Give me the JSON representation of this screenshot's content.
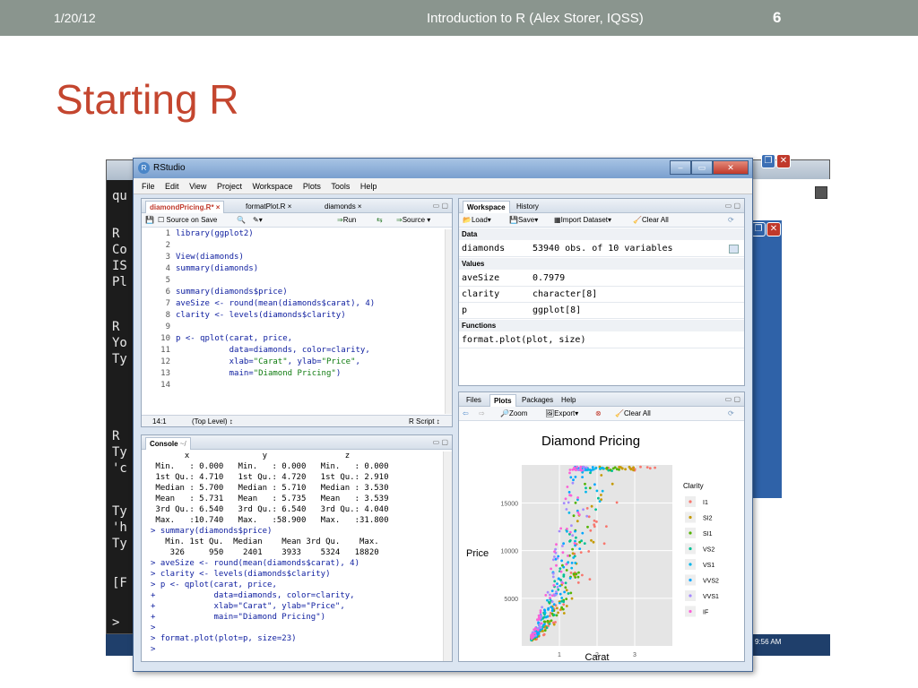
{
  "slide": {
    "date": "1/20/12",
    "course": "Introduction to R (Alex Storer, IQSS)",
    "page_number": "6",
    "title": "Starting R"
  },
  "background_console": {
    "lines": [
      "qu",
      "R",
      "Co",
      "IS",
      "Pl",
      "R",
      "Yo",
      "Ty",
      "R",
      "Ty",
      "'c",
      "Ty",
      "'h",
      "Ty",
      "[F",
      ">"
    ],
    "taskbar_time": "9:56 AM"
  },
  "rstudio": {
    "title": "RStudio",
    "menu": [
      "File",
      "Edit",
      "View",
      "Project",
      "Workspace",
      "Plots",
      "Tools",
      "Help"
    ],
    "editor": {
      "tabs": [
        "diamondPricing.R*",
        "formatPlot.R",
        "diamonds"
      ],
      "toolbar": {
        "source_on_save": "Source on Save",
        "run": "Run",
        "source": "Source"
      },
      "lines": [
        {
          "n": "1",
          "text": "library(ggplot2)"
        },
        {
          "n": "2",
          "text": ""
        },
        {
          "n": "3",
          "text": "View(diamonds)"
        },
        {
          "n": "4",
          "text": "summary(diamonds)"
        },
        {
          "n": "5",
          "text": ""
        },
        {
          "n": "6",
          "text": "summary(diamonds$price)"
        },
        {
          "n": "7",
          "text": "aveSize <- round(mean(diamonds$carat), 4)"
        },
        {
          "n": "8",
          "text": "clarity <- levels(diamonds$clarity)"
        },
        {
          "n": "9",
          "text": ""
        },
        {
          "n": "10",
          "text": "p <- qplot(carat, price,"
        },
        {
          "n": "11",
          "text": "           data=diamonds, color=clarity,"
        },
        {
          "n": "12",
          "text": "           xlab=\"Carat\", ylab=\"Price\","
        },
        {
          "n": "13",
          "text": "           main=\"Diamond Pricing\")"
        },
        {
          "n": "14",
          "text": ""
        }
      ],
      "status_pos": "14:1",
      "status_scope": "(Top Level) ↕",
      "status_type": "R Script ↕"
    },
    "console": {
      "title": "Console",
      "path": "~/",
      "lines": [
        "       x               y                z        ",
        " Min.   : 0.000   Min.   : 0.000   Min.   : 0.000",
        " 1st Qu.: 4.710   1st Qu.: 4.720   1st Qu.: 2.910",
        " Median : 5.700   Median : 5.710   Median : 3.530",
        " Mean   : 5.731   Mean   : 5.735   Mean   : 3.539",
        " 3rd Qu.: 6.540   3rd Qu.: 6.540   3rd Qu.: 4.040",
        " Max.   :10.740   Max.   :58.900   Max.   :31.800",
        "> summary(diamonds$price)",
        "   Min. 1st Qu.  Median    Mean 3rd Qu.    Max. ",
        "    326     950    2401    3933    5324   18820 ",
        "> aveSize <- round(mean(diamonds$carat), 4)",
        "> clarity <- levels(diamonds$clarity)",
        "> p <- qplot(carat, price,",
        "+            data=diamonds, color=clarity,",
        "+            xlab=\"Carat\", ylab=\"Price\",",
        "+            main=\"Diamond Pricing\")",
        ">",
        "> format.plot(plot=p, size=23)",
        "> "
      ]
    },
    "workspace": {
      "tabs": [
        "Workspace",
        "History"
      ],
      "toolbar": {
        "load": "Load",
        "save": "Save",
        "import": "Import Dataset",
        "clear": "Clear All"
      },
      "sections": {
        "data": "Data",
        "values": "Values",
        "functions": "Functions"
      },
      "data": [
        {
          "name": "diamonds",
          "value": "53940 obs. of 10 variables"
        }
      ],
      "values": [
        {
          "name": "aveSize",
          "value": "0.7979"
        },
        {
          "name": "clarity",
          "value": "character[8]"
        },
        {
          "name": "p",
          "value": "ggplot[8]"
        }
      ],
      "functions": [
        {
          "name": "format.plot(plot, size)",
          "value": ""
        }
      ]
    },
    "plots": {
      "tabs": [
        "Files",
        "Plots",
        "Packages",
        "Help"
      ],
      "toolbar": {
        "zoom": "Zoom",
        "export": "Export",
        "clear": "Clear All"
      }
    }
  },
  "chart_data": {
    "type": "scatter",
    "title": "Diamond Pricing",
    "xlabel": "Carat",
    "ylabel": "Price",
    "xticks": [
      1,
      2,
      3
    ],
    "yticks": [
      5000,
      10000,
      15000
    ],
    "xlim": [
      0,
      4
    ],
    "ylim": [
      0,
      19000
    ],
    "legend_title": "Clarity",
    "legend_position": "right",
    "grid": true,
    "series": [
      {
        "name": "I1",
        "color": "#f8766d"
      },
      {
        "name": "SI2",
        "color": "#c49a00"
      },
      {
        "name": "SI1",
        "color": "#53b400"
      },
      {
        "name": "VS2",
        "color": "#00c094"
      },
      {
        "name": "VS1",
        "color": "#00b6eb"
      },
      {
        "name": "VVS2",
        "color": "#00a6ff"
      },
      {
        "name": "VVS1",
        "color": "#a58aff"
      },
      {
        "name": "IF",
        "color": "#fb61d7"
      }
    ]
  }
}
